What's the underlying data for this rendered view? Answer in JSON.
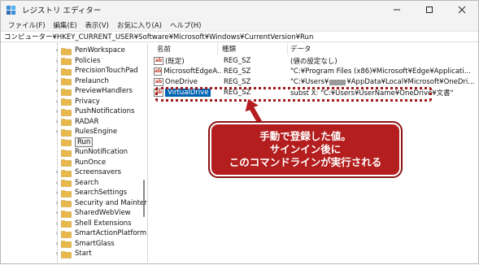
{
  "window": {
    "title": "レジストリ エディター",
    "controls": {
      "minimize": "—",
      "maximize": "□",
      "close": "✕"
    }
  },
  "menu": [
    "ファイル(F)",
    "編集(E)",
    "表示(V)",
    "お気に入り(A)",
    "ヘルプ(H)"
  ],
  "address": "コンピューター¥HKEY_CURRENT_USER¥Software¥Microsoft¥Windows¥CurrentVersion¥Run",
  "tree": {
    "items": [
      "PenWorkspace",
      "Policies",
      "PrecisionTouchPad",
      "Prelaunch",
      "PreviewHandlers",
      "Privacy",
      "PushNotifications",
      "RADAR",
      "RulesEngine",
      "Run",
      "RunNotification",
      "RunOnce",
      "Screensavers",
      "Search",
      "SearchSettings",
      "Security and Mainter",
      "SharedWebView",
      "Shell Extensions",
      "SmartActionPlatform",
      "SmartGlass",
      "Start"
    ],
    "expandable": [
      true,
      true,
      true,
      true,
      true,
      true,
      true,
      true,
      true,
      false,
      false,
      false,
      true,
      true,
      true,
      true,
      true,
      true,
      true,
      true,
      true
    ],
    "selected_index": 9
  },
  "columns": {
    "name": "名前",
    "type": "種類",
    "data": "データ"
  },
  "values": [
    {
      "name": "(既定)",
      "type": "REG_SZ",
      "data": "(値の設定なし)"
    },
    {
      "name": "MicrosoftEdgeA...",
      "type": "REG_SZ",
      "data": "\"C:¥Program Files (x86)¥Microsoft¥Edge¥Applicati..."
    },
    {
      "name": "OneDrive",
      "type": "REG_SZ",
      "data_prefix": "\"C:¥Users¥",
      "data_suffix": "¥AppData¥Local¥Microsoft¥OneDri..."
    },
    {
      "name": "VirtualDrive",
      "type": "REG_SZ",
      "data": "subst X: \"C:¥Users¥UserName¥OneDrive¥文書\""
    }
  ],
  "selected_value_index": 3,
  "callout": {
    "line1": "手動で登録した値。",
    "line2": "サインイン後に",
    "line3": "このコマンドラインが実行される"
  },
  "colors": {
    "accent": "#b41e1e",
    "selection": "#0063b1",
    "folder": "#e8b84a"
  }
}
